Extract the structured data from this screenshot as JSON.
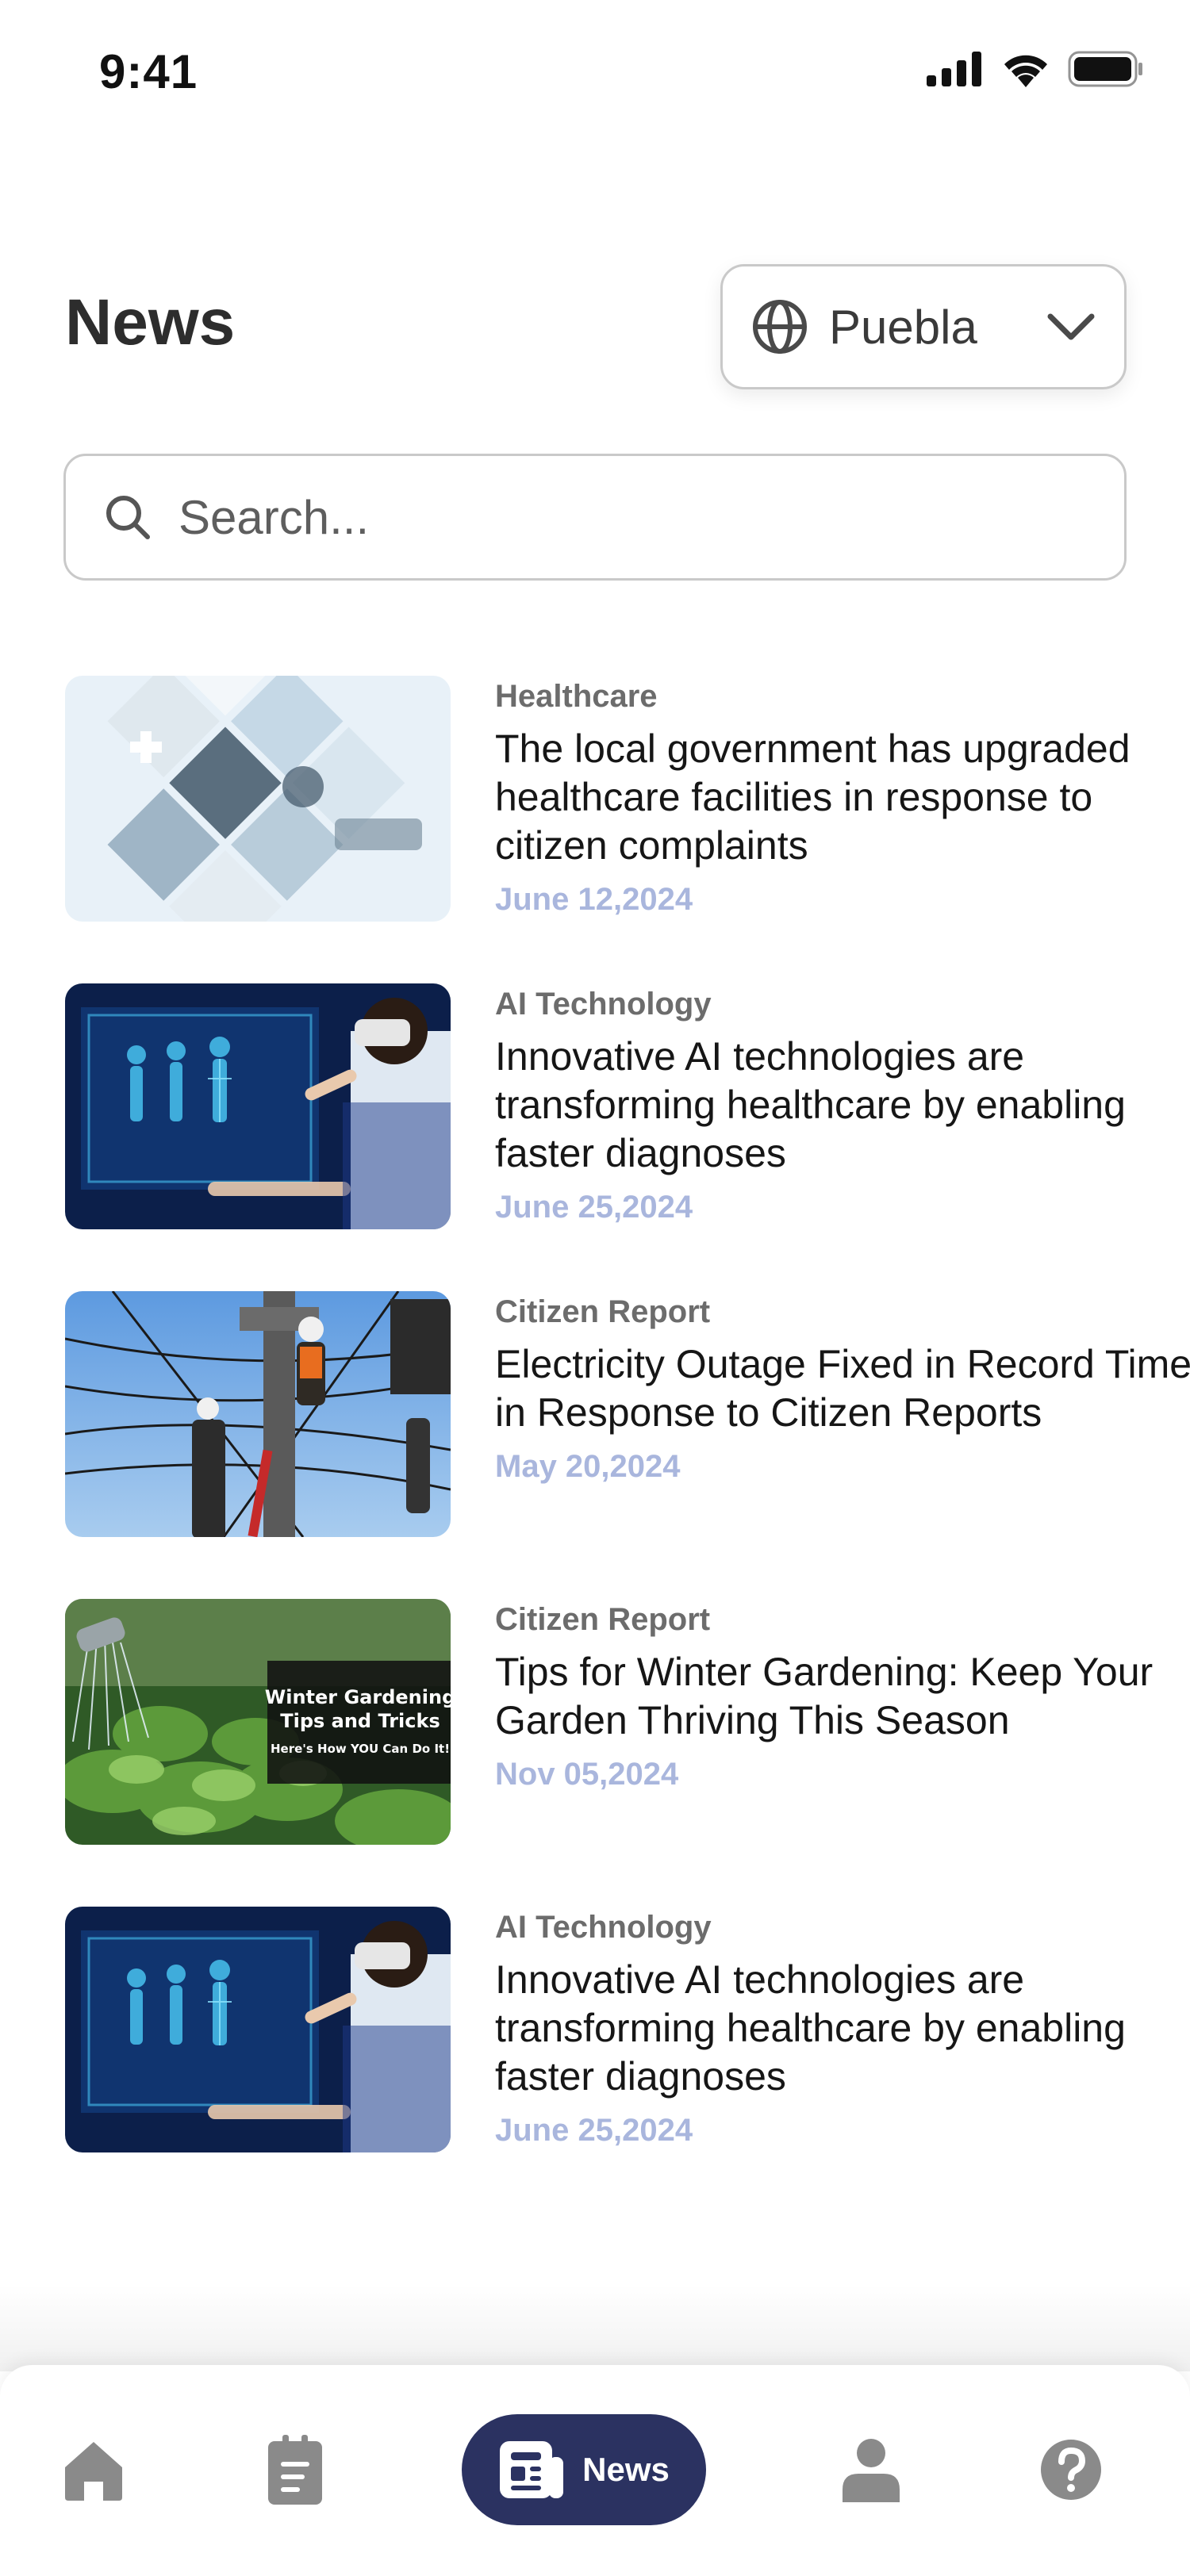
{
  "status_bar": {
    "time": "9:41"
  },
  "header": {
    "title": "News",
    "location": "Puebla"
  },
  "search": {
    "placeholder": "Search..."
  },
  "articles": [
    {
      "category": "Healthcare",
      "title": "The local government has upgraded healthcare facilities in response to citizen complaints",
      "date": "June 12,2024",
      "image": "healthcare-collage"
    },
    {
      "category": "AI Technology",
      "title": "Innovative AI technologies are transforming healthcare by enabling faster diagnoses",
      "date": "June 25,2024",
      "image": "ai-vr-doctor"
    },
    {
      "category": "Citizen Report",
      "title": "Electricity Outage Fixed in Record Time in Response to Citizen Reports",
      "date": "May 20,2024",
      "image": "electric-workers"
    },
    {
      "category": "Citizen Report",
      "title": "Tips for Winter Gardening: Keep Your Garden Thriving This Season",
      "date": "Nov 05,2024",
      "image": "garden-watering",
      "image_text": {
        "line1": "Winter Gardening",
        "line2": "Tips and Tricks",
        "line3": "Here's How YOU Can Do It!"
      }
    },
    {
      "category": "AI Technology",
      "title": "Innovative AI technologies are transforming healthcare by enabling faster diagnoses",
      "date": "June 25,2024",
      "image": "ai-vr-doctor"
    }
  ],
  "bottom_nav": {
    "items": [
      {
        "icon": "home-icon"
      },
      {
        "icon": "clipboard-icon"
      },
      {
        "icon": "newspaper-icon",
        "label": "News",
        "active": true
      },
      {
        "icon": "user-icon"
      },
      {
        "icon": "help-icon"
      }
    ]
  },
  "colors": {
    "accent": "#2b3261",
    "date": "#a9b6dd",
    "border": "#c9c9c9"
  }
}
